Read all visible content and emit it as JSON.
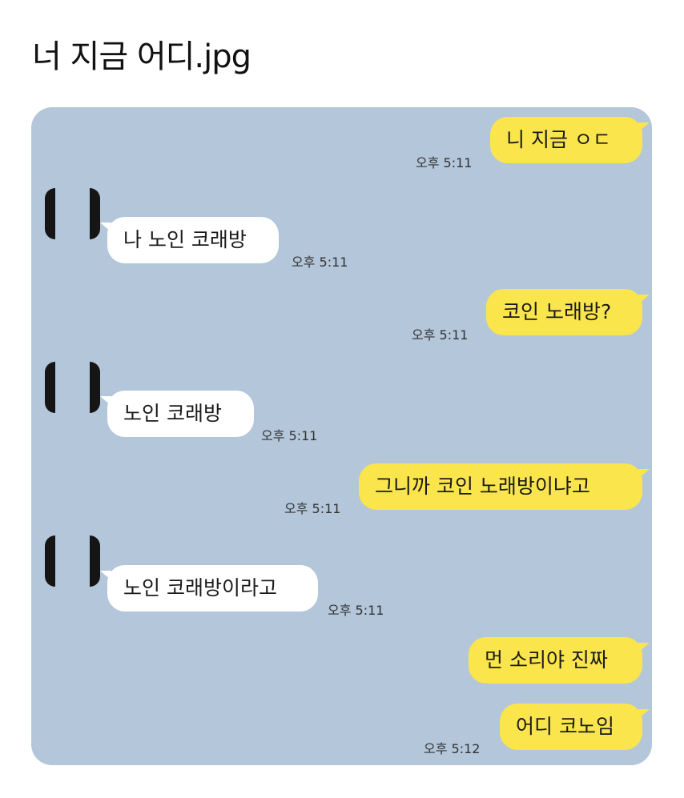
{
  "title": "너 지금 어디.jpg",
  "messages": [
    {
      "side": "me",
      "text": "니 지금 ㅇㄷ",
      "time": "오후 5:11"
    },
    {
      "side": "other",
      "text": "나 노인 코래방",
      "time": "오후 5:11"
    },
    {
      "side": "me",
      "text": "코인 노래방?",
      "time": "오후 5:11"
    },
    {
      "side": "other",
      "text": "노인 코래방",
      "time": "오후 5:11"
    },
    {
      "side": "me",
      "text": "그니까 코인 노래방이냐고",
      "time": "오후 5:11"
    },
    {
      "side": "other",
      "text": "노인 코래방이라고",
      "time": "오후 5:11"
    },
    {
      "side": "me",
      "text": "먼 소리야 진짜",
      "time": ""
    },
    {
      "side": "me",
      "text": "어디 코노임",
      "time": "오후 5:12"
    }
  ],
  "colors": {
    "chat_bg": "#b3c6da",
    "my_bubble": "#fae54d",
    "their_bubble": "#ffffff"
  }
}
